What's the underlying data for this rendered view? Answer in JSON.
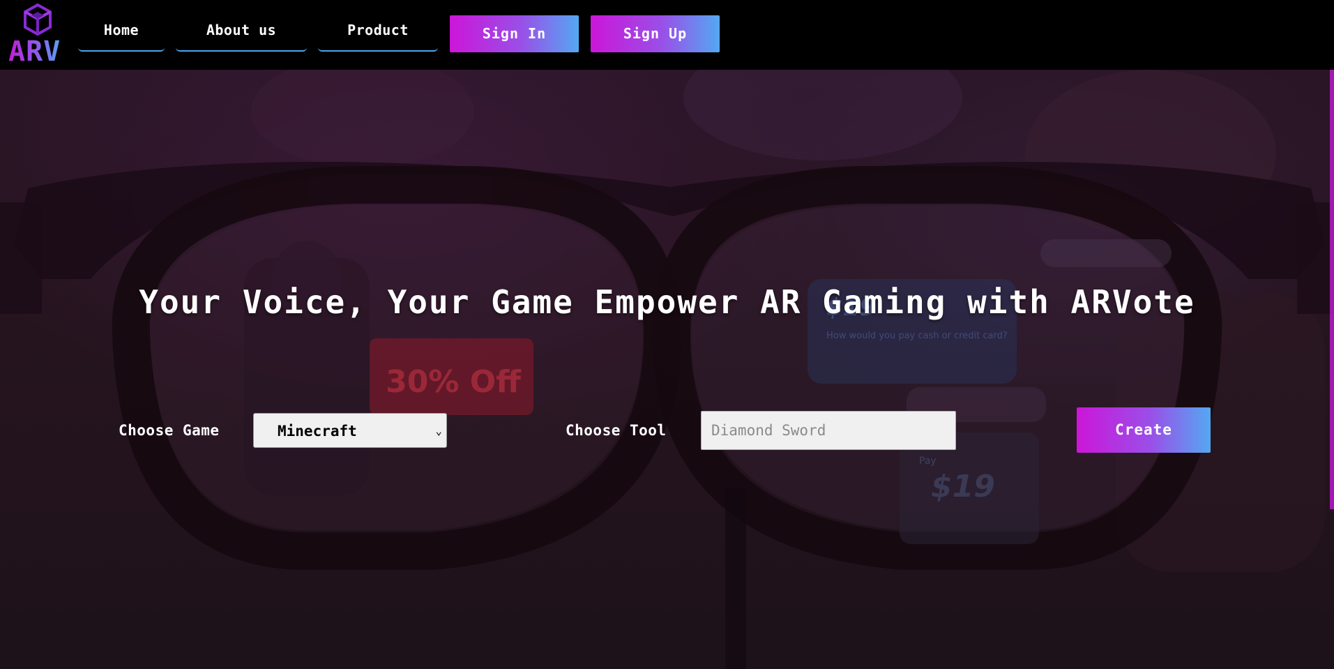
{
  "brand": {
    "logo_text": "ARV"
  },
  "nav": {
    "links": [
      {
        "label": "Home"
      },
      {
        "label": "About us"
      },
      {
        "label": "Product"
      }
    ],
    "sign_in": "Sign In",
    "sign_up": "Sign Up"
  },
  "hero": {
    "headline": "Your Voice, Your Game Empower AR Gaming with ARVote",
    "background_text": {
      "sale_tag": "30% Off",
      "price_card_price": "$19",
      "price_card_text": "How would you pay cash or credit card?",
      "price_tag_small": "Pay",
      "price_tag_price": "$19"
    }
  },
  "form": {
    "game_label": "Choose Game",
    "game_selected": "Minecraft",
    "tool_label": "Choose Tool",
    "tool_placeholder": "Diamond Sword",
    "tool_value": "",
    "create_label": "Create"
  },
  "colors": {
    "accent_start": "#cc16d8",
    "accent_end": "#54a8f2",
    "nav_underline": "#4aa6f0",
    "navbar_bg": "#000000"
  }
}
